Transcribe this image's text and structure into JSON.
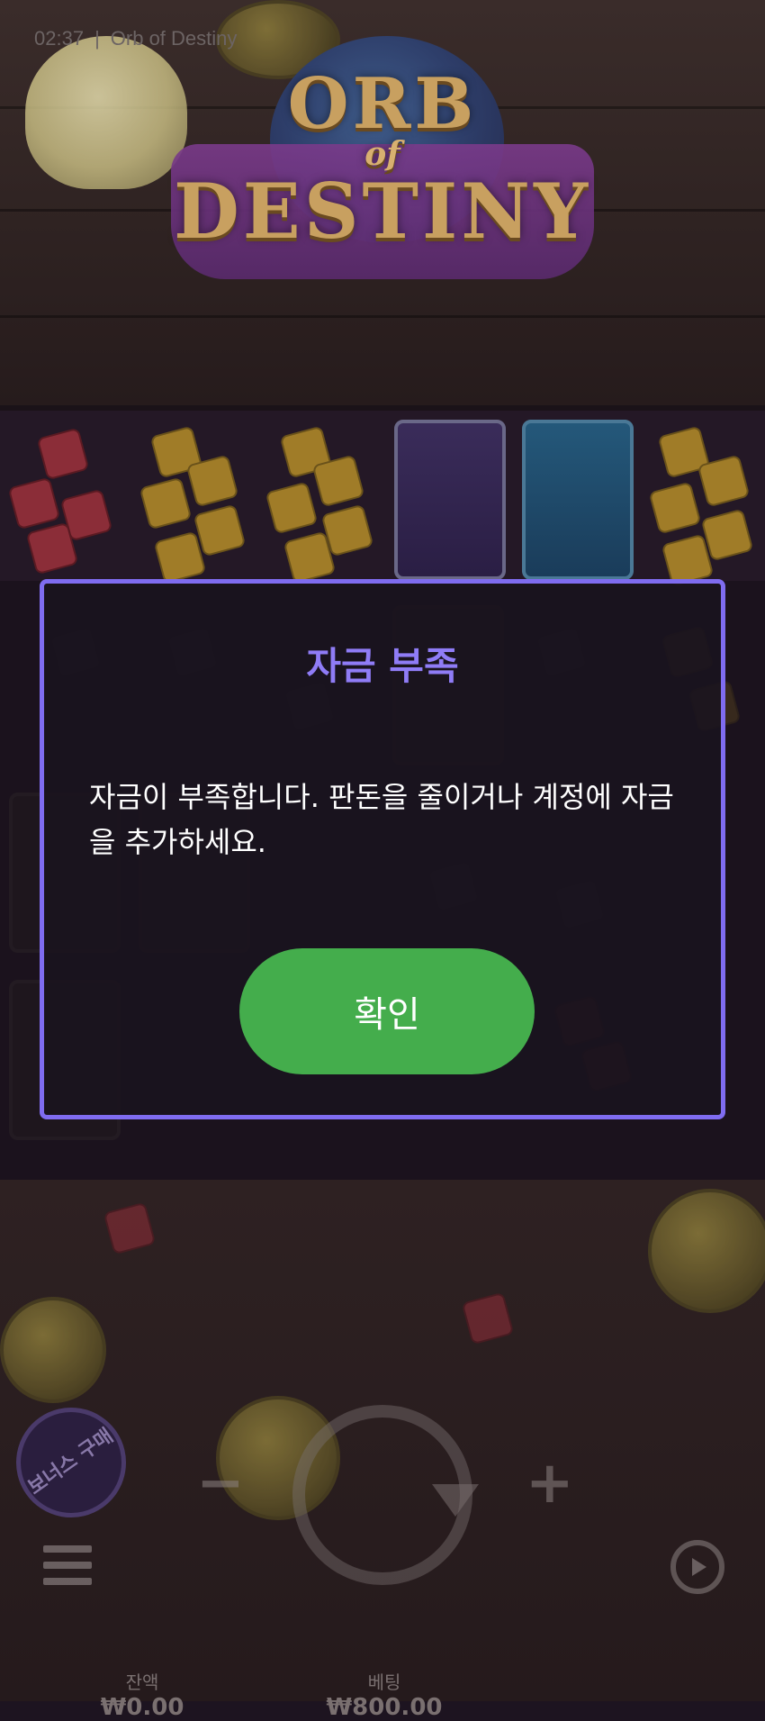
{
  "status_bar": {
    "time": "02:37",
    "separator": "|",
    "game_name": "Orb of Destiny"
  },
  "logo": {
    "line1": "ORB",
    "line2": "of",
    "line3": "DESTINY"
  },
  "dialog": {
    "title": "자금 부족",
    "message": "자금이 부족합니다. 판돈을 줄이거나 계정에 자금을 추가하세요.",
    "confirm_label": "확인"
  },
  "controls": {
    "bonus_buy_label": "보너스 구매",
    "minus_label": "−",
    "plus_label": "+",
    "menu_icon": "hamburger-menu-icon",
    "spin_icon": "spin-icon",
    "autoplay_icon": "autoplay-icon"
  },
  "stats": {
    "balance_label": "잔액",
    "balance_value": "₩0.00",
    "bet_label": "베팅",
    "bet_value": "₩800.00"
  },
  "colors": {
    "dialog_border": "#7f6cf0",
    "dialog_title": "#8f7cf6",
    "confirm_button": "#44ad4c"
  }
}
